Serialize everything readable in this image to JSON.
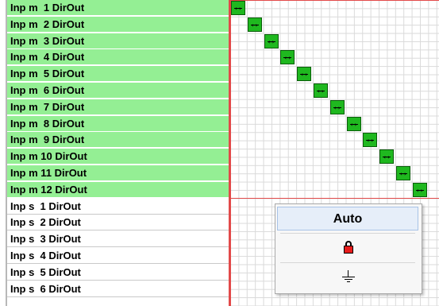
{
  "rows": [
    {
      "label": "Inp m  1 DirOut",
      "active": true
    },
    {
      "label": "Inp m  2 DirOut",
      "active": true
    },
    {
      "label": "Inp m  3 DirOut",
      "active": true
    },
    {
      "label": "Inp m  4 DirOut",
      "active": true
    },
    {
      "label": "Inp m  5 DirOut",
      "active": true
    },
    {
      "label": "Inp m  6 DirOut",
      "active": true
    },
    {
      "label": "Inp m  7 DirOut",
      "active": true
    },
    {
      "label": "Inp m  8 DirOut",
      "active": true
    },
    {
      "label": "Inp m  9 DirOut",
      "active": true
    },
    {
      "label": "Inp m 10 DirOut",
      "active": true
    },
    {
      "label": "Inp m 11 DirOut",
      "active": true
    },
    {
      "label": "Inp m 12 DirOut",
      "active": true
    },
    {
      "label": "Inp s  1 DirOut",
      "active": false
    },
    {
      "label": "Inp s  2 DirOut",
      "active": false
    },
    {
      "label": "Inp s  3 DirOut",
      "active": false
    },
    {
      "label": "Inp s  4 DirOut",
      "active": false
    },
    {
      "label": "Inp s  5 DirOut",
      "active": false
    },
    {
      "label": "Inp s  6 DirOut",
      "active": false
    }
  ],
  "crosspoints": [
    {
      "row": 1,
      "col": 1
    },
    {
      "row": 2,
      "col": 2
    },
    {
      "row": 3,
      "col": 3
    },
    {
      "row": 4,
      "col": 4
    },
    {
      "row": 5,
      "col": 5
    },
    {
      "row": 6,
      "col": 6
    },
    {
      "row": 7,
      "col": 7
    },
    {
      "row": 8,
      "col": 8
    },
    {
      "row": 9,
      "col": 9
    },
    {
      "row": 10,
      "col": 10
    },
    {
      "row": 11,
      "col": 11
    },
    {
      "row": 12,
      "col": 12
    }
  ],
  "popup": {
    "items": [
      {
        "label": "Auto",
        "selected": true
      },
      {
        "icon": "lock-icon",
        "selected": false
      },
      {
        "icon": "ground-icon",
        "selected": false
      }
    ]
  },
  "colors": {
    "active_row": "#94ef94",
    "crosspoint": "#1fb81f",
    "block_line": "#e24a4a",
    "grid_line": "#dadada"
  }
}
